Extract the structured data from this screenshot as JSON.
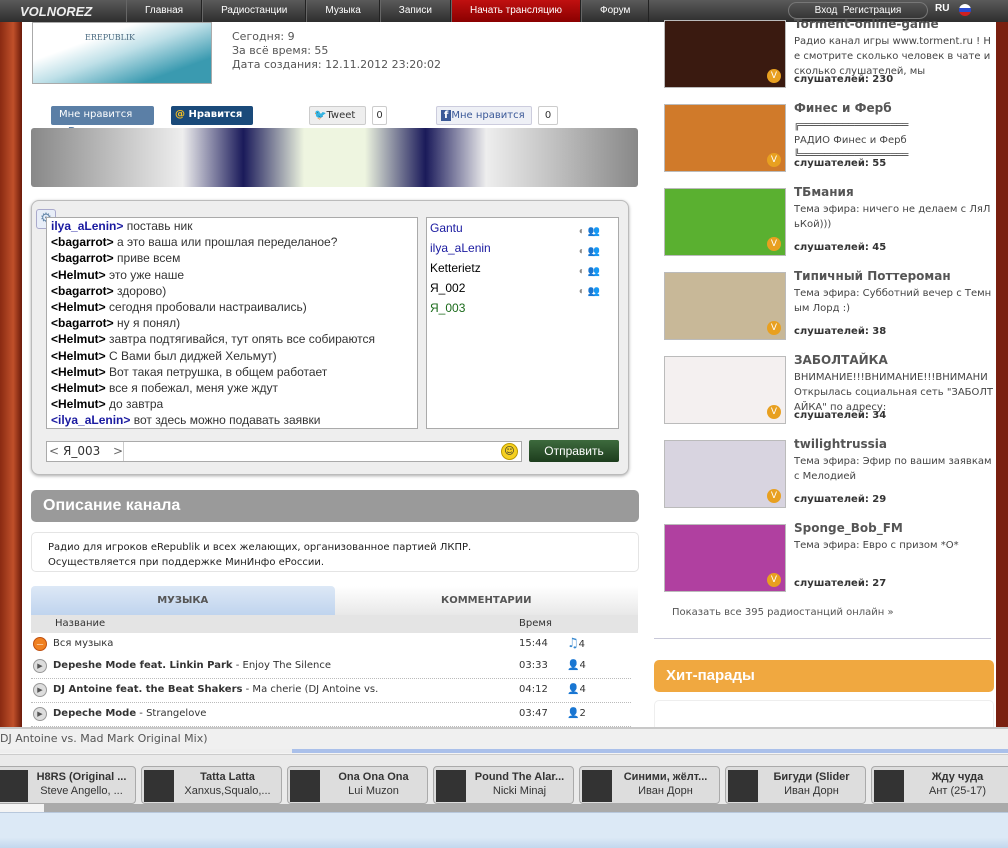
{
  "nav": {
    "logo": "VOLNOREZ",
    "items": [
      "Главная",
      "Радиостанции",
      "Музыка",
      "Записи",
      "Начать трансляцию",
      "Форум"
    ],
    "login": "Вход",
    "register": "Регистрация",
    "lang": "RU"
  },
  "channel": {
    "logo_text": "EREPUBLIK",
    "today": "Сегодня: 9",
    "total": "За всё время: 55",
    "created": "Дата создания: 12.11.2012 23:20:02"
  },
  "social": {
    "vk": "Мне нравится",
    "vk_b": "В",
    "mail": "Нравится",
    "tweet": "Tweet",
    "tweet_count": "0",
    "fb": "Мне нравится",
    "fb_count": "0"
  },
  "chat": {
    "messages": [
      {
        "user": "ilya_aLenin>",
        "text": " поставь ник",
        "color": "#1a1aa0"
      },
      {
        "user": "<bagarrot>",
        "text": " а это ваша или прошлая переделаное?",
        "color": "#000"
      },
      {
        "user": "<bagarrot>",
        "text": " приве всем",
        "color": "#000"
      },
      {
        "user": "<Helmut>",
        "text": " это уже наше",
        "color": "#000"
      },
      {
        "user": "<bagarrot>",
        "text": " здорово)",
        "color": "#000"
      },
      {
        "user": "<Helmut>",
        "text": " сегодня пробовали настраивались)",
        "color": "#000"
      },
      {
        "user": "<bagarrot>",
        "text": " ну я понял)",
        "color": "#000"
      },
      {
        "user": "<Helmut>",
        "text": " завтра подтягивайся, тут опять все собираются",
        "color": "#000"
      },
      {
        "user": "<Helmut>",
        "text": " С Вами был диджей Хельмут)",
        "color": "#000"
      },
      {
        "user": "<Helmut>",
        "text": " Вот такая петрушка, в общем работает",
        "color": "#000"
      },
      {
        "user": "<Helmut>",
        "text": " все я побежал, меня уже ждут",
        "color": "#000"
      },
      {
        "user": "<Helmut>",
        "text": " до завтра",
        "color": "#000"
      },
      {
        "user": "<ilya_aLenin>",
        "text": " вот здесь можно подавать заявки",
        "color": "#1a1aa0"
      }
    ],
    "users": [
      {
        "name": "Gantu",
        "color": "#1a1aa0",
        "icons": true
      },
      {
        "name": "ilya_aLenin",
        "color": "#1a1aa0",
        "icons": true
      },
      {
        "name": "Ketterietz",
        "color": "#000",
        "icons": true
      },
      {
        "name": "Я_002",
        "color": "#000",
        "icons": true
      },
      {
        "name": "Я_003",
        "color": "#1a6a1a",
        "icons": false
      }
    ],
    "nick": "Я_003",
    "input_value": "",
    "send": "Отправить"
  },
  "description": {
    "title": "Описание канала",
    "line1": "Радио для игроков eRepublik и всех желающих, организованное партией ЛКПР.",
    "line2": "Осуществляется при поддержке МинИнфо еРоссии."
  },
  "music": {
    "tabs": [
      "МУЗЫКА",
      "КОММЕНТАРИИ"
    ],
    "col_name": "Название",
    "col_time": "Время",
    "all": {
      "label": "Вся музыка",
      "time": "15:44",
      "count": "4"
    },
    "tracks": [
      {
        "artist": "Depeshe Mode feat. Linkin Park",
        "title": " - Enjoy The Silence",
        "time": "03:33",
        "count": "4"
      },
      {
        "artist": "DJ Antoine feat. the Beat Shakers",
        "title": " - Ma cherie (DJ Antoine vs.",
        "time": "04:12",
        "count": "4"
      },
      {
        "artist": "Depeche Mode",
        "title": " - Strangelove",
        "time": "03:47",
        "count": "2"
      }
    ]
  },
  "stations": [
    {
      "title": "Torment-online-game",
      "desc": "Радио канал игры www.torment.ru ! Не смотрите сколько человек в чате и сколько слушателей, мы",
      "listeners": "слушателей: 230",
      "color": "#3a1a10"
    },
    {
      "title": "Финес и Ферб",
      "desc": "╔══════════════════\nРАДИО Финес и Ферб\n╚══════════════════",
      "listeners": "слушателей: 55",
      "color": "#d07a2a"
    },
    {
      "title": "ТБмания",
      "desc": "Тема эфира: ничего не делаем с ЛяЛьКой)))",
      "listeners": "слушателей: 45",
      "color": "#5ab030"
    },
    {
      "title": "Типичный Поттероман",
      "desc": "Тема эфира: Субботний вечер с Темным Лорд :)",
      "listeners": "слушателей: 38",
      "color": "#c8b898"
    },
    {
      "title": "ЗАБОЛТАЙКА",
      "desc": "ВНИМАНИЕ!!!ВНИМАНИЕ!!!ВНИМАНИ Открылась социальная сеть \"ЗАБОЛТАЙКА\" по адресу:",
      "listeners": "слушателей: 34",
      "color": "#f4f0f0"
    },
    {
      "title": "twilightrussia",
      "desc": "Тема эфира: Эфир по вашим заявкам с Мелодией",
      "listeners": "слушателей: 29",
      "color": "#d8d4e0"
    },
    {
      "title": "Sponge_Bob_FM",
      "desc": "Тема эфира: Евро с призом *O*",
      "listeners": "слушателей: 27",
      "color": "#b040a0"
    }
  ],
  "show_all": "Показать все 395 радиостанций онлайн »",
  "hits": {
    "title": "Хит-парады"
  },
  "player": {
    "now_playing": "DJ Antoine vs. Mad Mark Original Mix)",
    "progress": 0.29,
    "tiles": [
      {
        "title": "H8RS (Original ...",
        "artist": "Steve Angello, ..."
      },
      {
        "title": "Tatta Latta",
        "artist": "Xanxus,Squalo,..."
      },
      {
        "title": "Ona Ona Ona",
        "artist": "Lui Muzon"
      },
      {
        "title": "Pound The Alar...",
        "artist": "Nicki Minaj"
      },
      {
        "title": "Синими, жёлт...",
        "artist": "Иван Дорн"
      },
      {
        "title": "Бигуди (Slider",
        "artist": "Иван Дорн"
      },
      {
        "title": "Жду чуда",
        "artist": "Ант (25-17)"
      }
    ]
  }
}
